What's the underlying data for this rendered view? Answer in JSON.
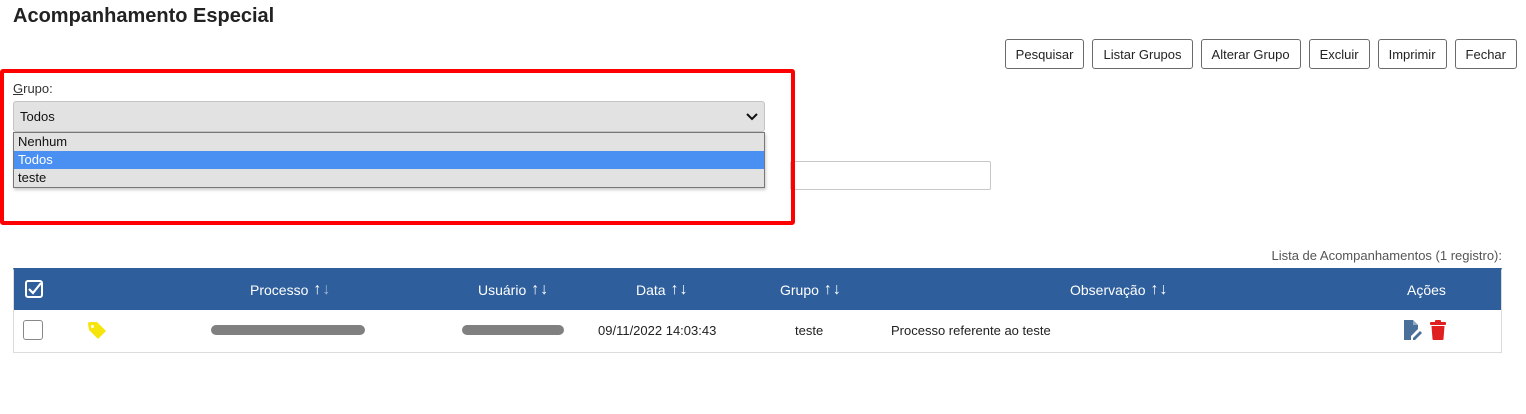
{
  "page": {
    "title": "Acompanhamento Especial"
  },
  "toolbar": {
    "buttons": [
      {
        "name": "pesquisar",
        "label": "Pesquisar"
      },
      {
        "name": "listar-grupos",
        "label": "Listar Grupos"
      },
      {
        "name": "alterar-grupo",
        "label": "Alterar Grupo"
      },
      {
        "name": "excluir",
        "label": "Excluir"
      },
      {
        "name": "imprimir",
        "label": "Imprimir"
      },
      {
        "name": "fechar",
        "label": "Fechar"
      }
    ]
  },
  "filter": {
    "label": "Grupo:",
    "selected": "Todos",
    "options": [
      "Nenhum",
      "Todos",
      "teste"
    ]
  },
  "list": {
    "caption": "Lista de Acompanhamentos (1 registro):",
    "columns": {
      "processo": "Processo",
      "usuario": "Usuário",
      "data": "Data",
      "grupo": "Grupo",
      "observacao": "Observação",
      "acoes": "Ações"
    },
    "rows": [
      {
        "data": "09/11/2022 14:03:43",
        "grupo": "teste",
        "observacao": "Processo referente ao teste"
      }
    ]
  },
  "icons": {
    "header_check": "checkbox-checked-icon",
    "tag": "tag-icon",
    "edit": "edit-document-icon",
    "delete": "trash-icon"
  },
  "colors": {
    "header_bg": "#2e5e9b",
    "highlight": "#ff0000",
    "selected_option": "#4a90f2",
    "tag": "#f5e50a",
    "edit_icon": "#4a6f9a",
    "delete_icon": "#e02020"
  }
}
